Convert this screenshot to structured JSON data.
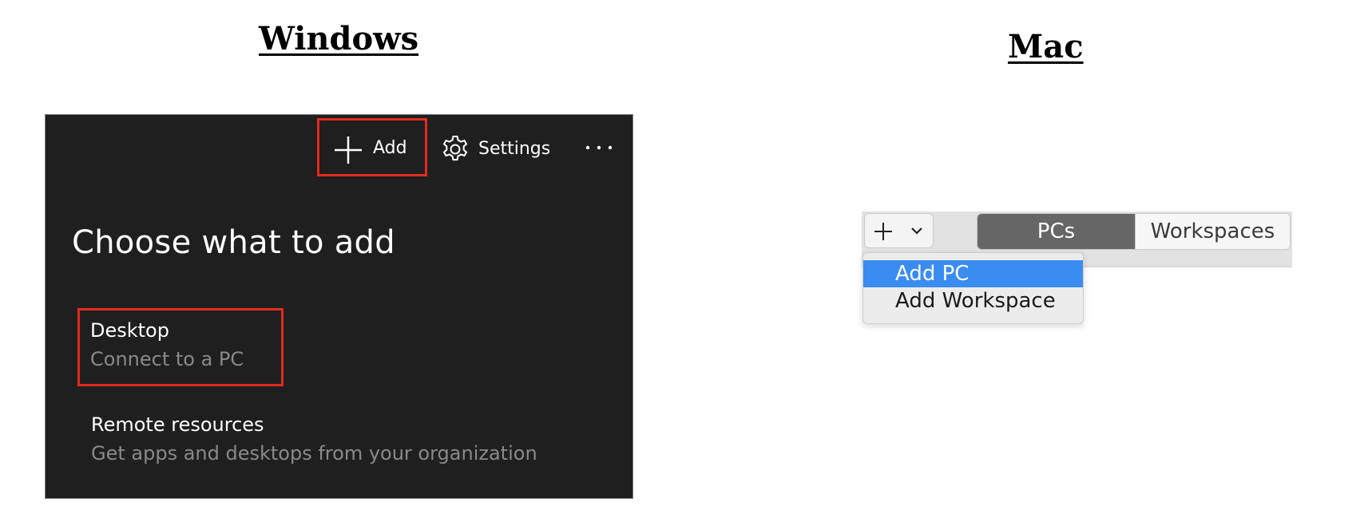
{
  "headings": {
    "windows": "Windows",
    "mac": "Mac"
  },
  "windows_app": {
    "toolbar": {
      "add_label": "Add",
      "settings_label": "Settings",
      "more_label": "···"
    },
    "title": "Choose what to add",
    "options": [
      {
        "title": "Desktop",
        "subtitle": "Connect to a PC",
        "highlighted": true
      },
      {
        "title": "Remote resources",
        "subtitle": "Get apps and desktops from your organization",
        "highlighted": false
      }
    ],
    "colors": {
      "background": "#1f1f1f",
      "highlight": "#e02b1f",
      "secondary_text": "#8a8a8a"
    },
    "icons": {
      "add": "plus-icon",
      "settings": "gear-icon",
      "more": "more-icon"
    }
  },
  "mac_app": {
    "segments": [
      {
        "label": "PCs",
        "selected": true
      },
      {
        "label": "Workspaces",
        "selected": false
      }
    ],
    "add_menu": [
      {
        "label": "Add PC",
        "selected": true
      },
      {
        "label": "Add Workspace",
        "selected": false
      }
    ],
    "colors": {
      "selected_segment": "#666666",
      "menu_selection": "#3b8cf0"
    },
    "icons": {
      "add": "plus-icon",
      "dropdown": "chevron-down-icon"
    }
  }
}
